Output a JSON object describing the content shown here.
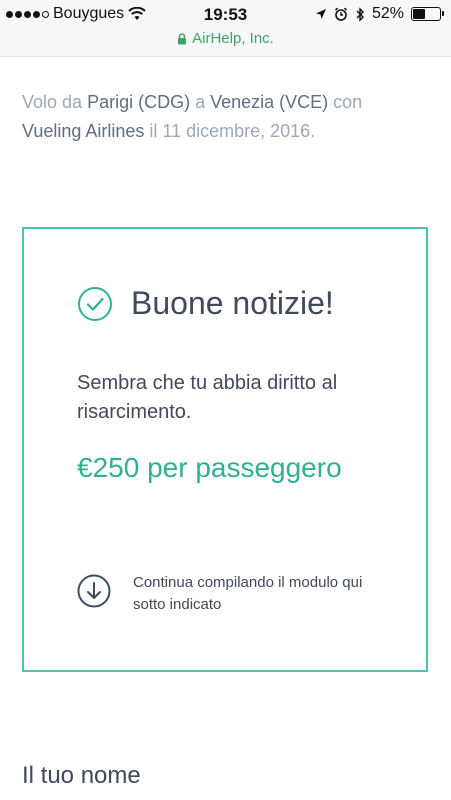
{
  "status_bar": {
    "carrier": "Bouygues",
    "time": "19:53",
    "battery": "52%",
    "battery_level": 0.52,
    "url": "AirHelp, Inc."
  },
  "intro": {
    "p1": "Volo da ",
    "origin": "Parigi (CDG)",
    "p2": " a ",
    "destination": "Venezia (VCE)",
    "p3": " con ",
    "airline": "Vueling Airlines",
    "p4": " il 11 dicembre, 2016."
  },
  "card": {
    "title": "Buone notizie!",
    "description": "Sembra che tu abbia diritto al risarcimento.",
    "amount": "€250 per passeggero",
    "continue_text": "Continua compilando il modulo qui sotto indicato"
  },
  "form": {
    "name_label": "Il tuo nome"
  },
  "colors": {
    "accent": "#2fb193",
    "border": "#4cc2b2",
    "text": "#3f4a5a",
    "muted": "#9aa8b8"
  }
}
